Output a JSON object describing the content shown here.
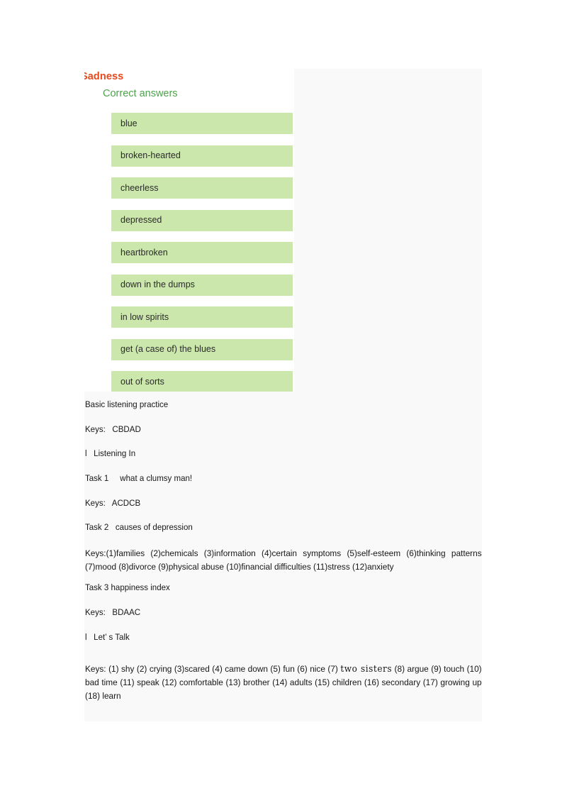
{
  "document": {
    "quiz": {
      "title": "Sadness",
      "answers_heading": "Correct answers",
      "answers": [
        "blue",
        "broken-hearted",
        "cheerless",
        "depressed",
        "heartbroken",
        "down in the dumps",
        "in low spirits",
        "get (a case of) the blues",
        "out of sorts"
      ]
    },
    "notes": {
      "basic_listening_practice": "Basic listening practice",
      "keys_basic": "Keys:   CBDAD",
      "section_listening_in": "l   Listening In",
      "task1_title": "Task 1     what a clumsy man!",
      "keys_task1": "Keys:   ACDCB",
      "task2_title": "Task 2   causes of depression",
      "keys_task2": "Keys:(1)families  (2)chemicals  (3)information  (4)certain symptoms  (5)self-esteem (6)thinking patterns (7)mood (8)divorce (9)physical abuse (10)financial difficulties (11)stress (12)anxiety",
      "task3_title": "Task 3 happiness index",
      "keys_task3": "Keys:   BDAAC",
      "section_lets_talk": "l   Let’ s Talk",
      "keys_lets_talk_before": "Keys: (1) shy (2) crying (3)scared (4) came down (5) fun (6) nice (7) ",
      "keys_lets_talk_emphasis": "two sisters",
      "keys_lets_talk_after": " (8) argue (9) touch (10) bad time (11) speak (12) comfortable (13) brother (14) adults (15) children (16) secondary (17) growing up (18) learn"
    },
    "colors": {
      "title_orange": "#e8491d",
      "heading_green": "#4ea24e",
      "answer_box_green": "#cbe7ab",
      "panel_grey": "#f9f9f9",
      "body_text": "#171717"
    }
  }
}
